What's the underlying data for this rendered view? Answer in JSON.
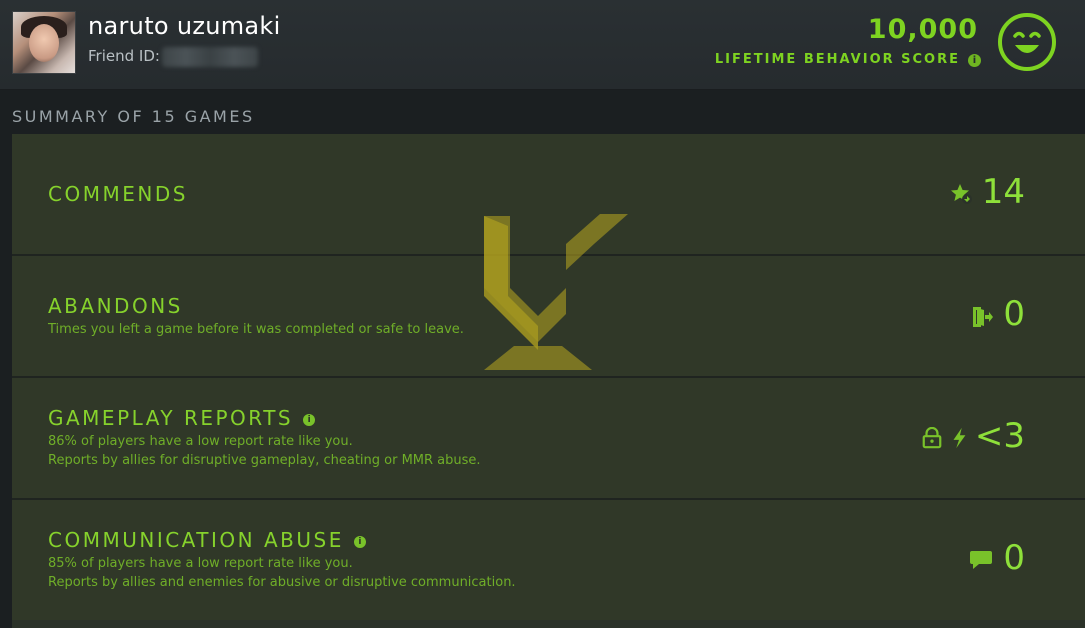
{
  "header": {
    "username": "naruto uzumaki",
    "friend_id_label": "Friend ID:",
    "score": "10,000",
    "score_label": "LIFETIME BEHAVIOR SCORE",
    "accent": "#7ed321"
  },
  "summary": {
    "title": "SUMMARY OF 15 GAMES"
  },
  "rows": [
    {
      "title": "COMMENDS",
      "icon": "star-commend-icon",
      "value": "14"
    },
    {
      "title": "ABANDONS",
      "subtitle": "Times you left a game before it was completed or safe to leave.",
      "icon": "exit-door-icon",
      "value": "0"
    },
    {
      "title": "GAMEPLAY REPORTS",
      "subtitle_1": "86% of players have a low report rate like you.",
      "subtitle_2": "Reports by allies for disruptive gameplay, cheating or MMR abuse.",
      "icon": "lock-lightning-icon",
      "value": "<3"
    },
    {
      "title": "COMMUNICATION ABUSE",
      "subtitle_1": "85% of players have a low report rate like you.",
      "subtitle_2": "Reports by allies and enemies for abusive or disruptive communication.",
      "icon": "chat-bubble-icon",
      "value": "0"
    }
  ]
}
